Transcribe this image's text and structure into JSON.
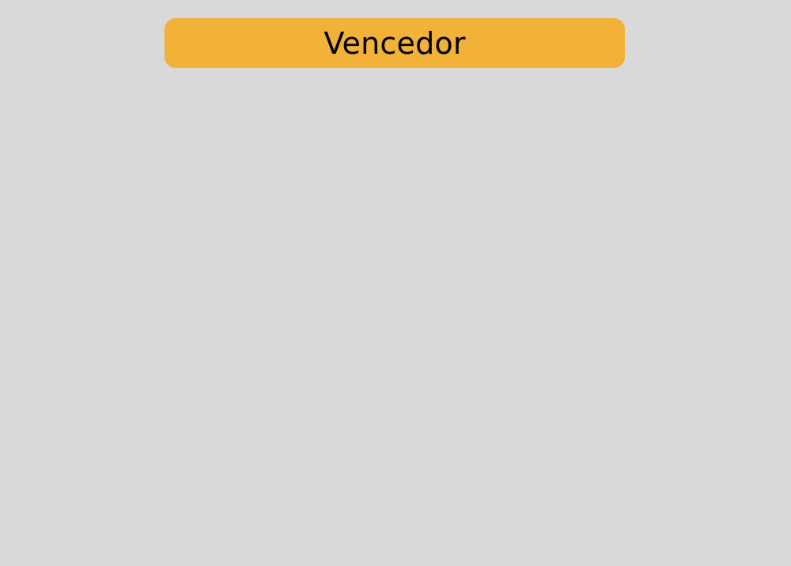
{
  "banner": {
    "title": "Vencedor",
    "background_color": "#f2b138",
    "text_color": "#000000"
  },
  "page": {
    "background_color": "#d9d9d9"
  }
}
